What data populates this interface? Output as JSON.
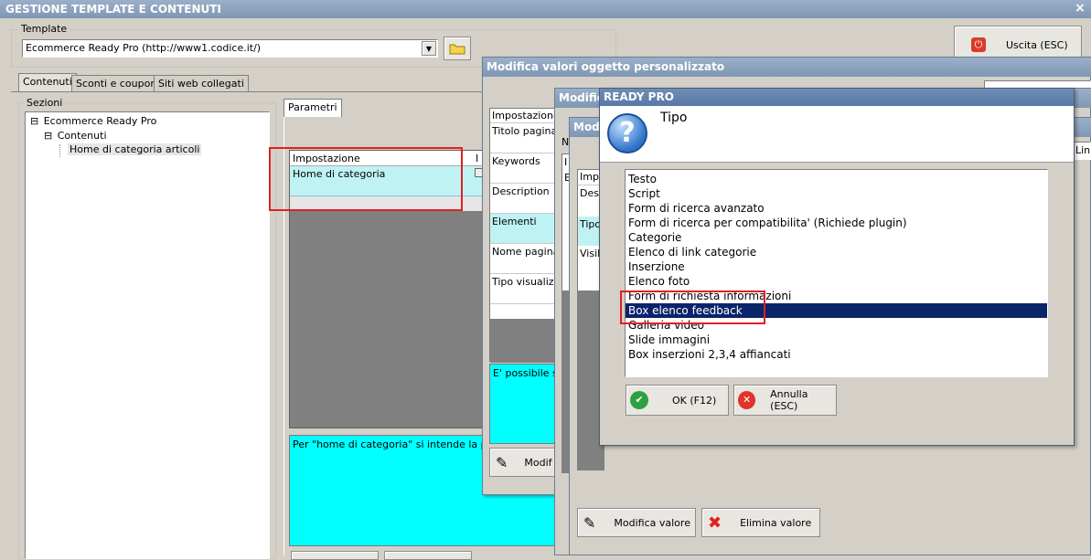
{
  "main_window": {
    "title": "GESTIONE TEMPLATE E CONTENUTI",
    "close_glyph": "×",
    "template_label": "Template",
    "template_value": "Ecommerce Ready Pro (http://www1.codice.it/)",
    "exit_button": "Uscita (ESC)",
    "tabs": [
      "Contenuti",
      "Sconti e coupon",
      "Siti web collegati"
    ],
    "sections_label": "Sezioni",
    "tree": {
      "root": "Ecommerce Ready Pro",
      "child": "Contenuti",
      "leaf": "Home di categoria articoli",
      "expander": "⊟"
    },
    "params_tab": "Parametri",
    "grid_header": "Impostazione",
    "grid_header2": "I",
    "grid_row": "Home di categoria",
    "description": "Per \"home di categoria\" si intende la pagina"
  },
  "edit_window": {
    "title": "Modifica valori oggetto personalizzato",
    "grid_header": "Impostazione",
    "rows": [
      "Titolo pagina",
      "Keywords",
      "Description",
      "Elementi",
      "Nome pagina p",
      "Tipo visualizza"
    ],
    "info_text": "E' possibile spe",
    "modify_button": "Modif"
  },
  "window3": {
    "title_fragment": "Modific",
    "label_n": "N",
    "header_fragment": "I",
    "row_fragment": "E",
    "modify_button": "Modifica valore",
    "delete_button": "Elimina valore"
  },
  "window4": {
    "title_fragment": "Modi",
    "header_fragment": "Impo",
    "rows": [
      "Desc",
      "Tipo",
      "Visib"
    ],
    "right_text": "Ling"
  },
  "dialog": {
    "title": "READY PRO",
    "heading": "Tipo",
    "question_glyph": "?",
    "options": [
      "Testo",
      "Script",
      "Form di ricerca avanzato",
      "Form di ricerca per compatibilita' (Richiede plugin)",
      "Categorie",
      "Elenco di link categorie",
      "Inserzione",
      "Elenco foto",
      "Form di richiesta informazioni",
      "Box elenco feedback",
      "Galleria video",
      "Slide immagini",
      "Box inserzioni 2,3,4 affiancati"
    ],
    "selected_index": 9,
    "ok_button": "OK (F12)",
    "cancel_button": "Annulla (ESC)"
  },
  "colors": {
    "selection": "#0a246a",
    "cyan_panel": "#00ffff",
    "light_cyan": "#bff3f3",
    "dark_gray": "#808080",
    "highlight_rect": "#e02020"
  }
}
